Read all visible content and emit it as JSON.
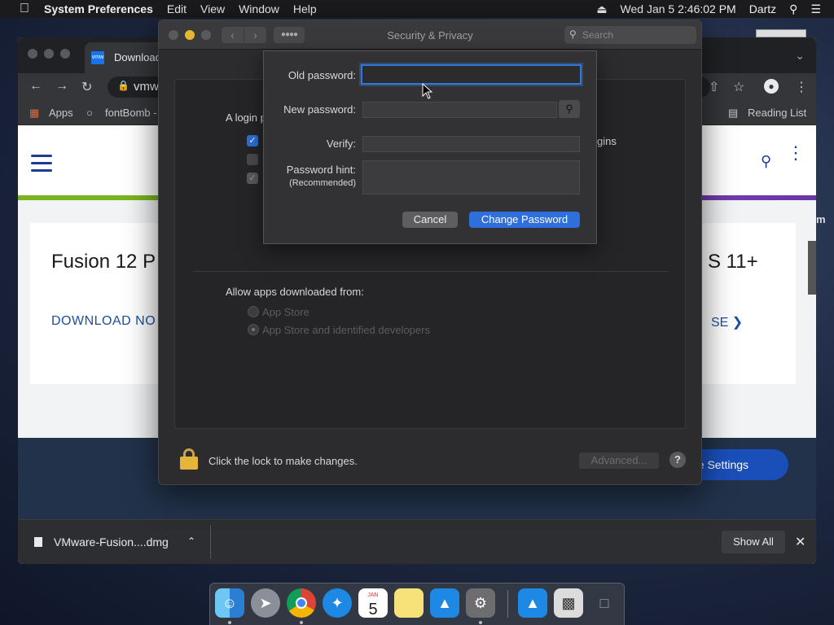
{
  "menubar": {
    "app_name": "System Preferences",
    "items": [
      "Edit",
      "View",
      "Window",
      "Help"
    ],
    "datetime": "Wed Jan 5  2:46:02 PM",
    "user": "Dartz"
  },
  "browser": {
    "tab_title": "Download",
    "tab_favicon": "vmw",
    "url": "vmw",
    "bookmarks": {
      "apps": "Apps",
      "fontbomb": "fontBomb -",
      "reading_list": "Reading List"
    },
    "page": {
      "card_title_left": "Fusion 12 P",
      "card_title_right": "S 11+",
      "card_link_left": "DOWNLOAD NO",
      "card_link_right": "SE",
      "cookie_button": "Cookie Settings",
      "side_text": "m"
    },
    "download_shelf": {
      "file_name": "VMware-Fusion....dmg",
      "show_all": "Show All"
    }
  },
  "syspref": {
    "title": "Security & Privacy",
    "search_placeholder": "Search",
    "login_text": "A login p",
    "logins_text": "gins",
    "allow_apps_label": "Allow apps downloaded from:",
    "options": [
      "App Store",
      "App Store and identified developers"
    ],
    "lock_text": "Click the lock to make changes.",
    "advanced_button": "Advanced...",
    "help_button": "?"
  },
  "dialog": {
    "old_password_label": "Old password:",
    "new_password_label": "New password:",
    "verify_label": "Verify:",
    "hint_label": "Password hint:",
    "hint_sublabel": "(Recommended)",
    "old_password_value": "",
    "new_password_value": "",
    "verify_value": "",
    "hint_value": "",
    "cancel_button": "Cancel",
    "change_button": "Change Password"
  },
  "dock": {
    "calendar_month": "JAN",
    "calendar_day": "5"
  },
  "colors": {
    "accent": "#2f6fdc",
    "lock": "#e5b53a"
  }
}
